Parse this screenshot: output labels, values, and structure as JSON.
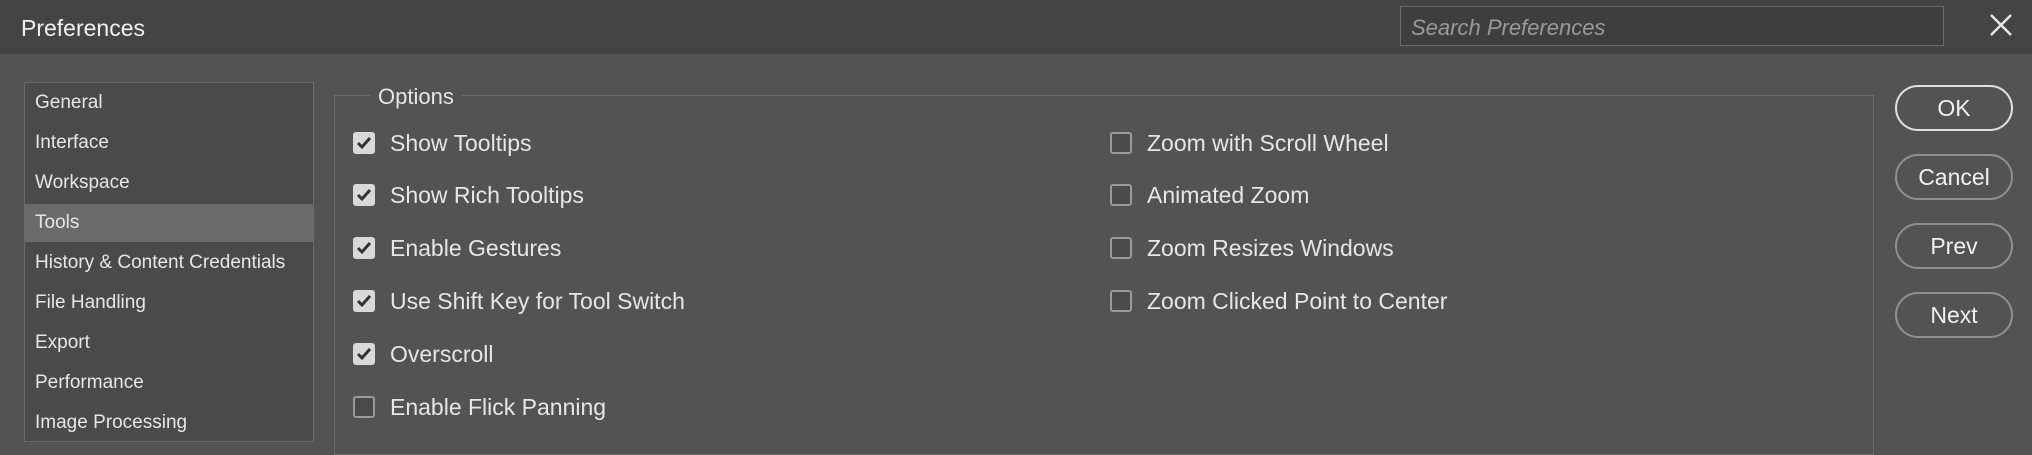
{
  "window": {
    "title": "Preferences",
    "search_placeholder": "Search Preferences",
    "close_icon": "close-icon"
  },
  "sidebar": {
    "items": [
      {
        "label": "General",
        "selected": false
      },
      {
        "label": "Interface",
        "selected": false
      },
      {
        "label": "Workspace",
        "selected": false
      },
      {
        "label": "Tools",
        "selected": true
      },
      {
        "label": "History & Content Credentials",
        "selected": false
      },
      {
        "label": "File Handling",
        "selected": false
      },
      {
        "label": "Export",
        "selected": false
      },
      {
        "label": "Performance",
        "selected": false
      },
      {
        "label": "Image Processing",
        "selected": false
      }
    ]
  },
  "options": {
    "legend": "Options",
    "left": [
      {
        "label": "Show Tooltips",
        "checked": true
      },
      {
        "label": "Show Rich Tooltips",
        "checked": true
      },
      {
        "label": "Enable Gestures",
        "checked": true
      },
      {
        "label": "Use Shift Key for Tool Switch",
        "checked": true
      },
      {
        "label": "Overscroll",
        "checked": true
      },
      {
        "label": "Enable Flick Panning",
        "checked": false
      }
    ],
    "right": [
      {
        "label": "Zoom with Scroll Wheel",
        "checked": false
      },
      {
        "label": "Animated Zoom",
        "checked": false
      },
      {
        "label": "Zoom Resizes Windows",
        "checked": false
      },
      {
        "label": "Zoom Clicked Point to Center",
        "checked": false
      }
    ]
  },
  "buttons": {
    "ok": "OK",
    "cancel": "Cancel",
    "prev": "Prev",
    "next": "Next"
  },
  "colors": {
    "background": "#535353",
    "titlebar": "#444444",
    "selected_item": "#6a6a6a"
  }
}
